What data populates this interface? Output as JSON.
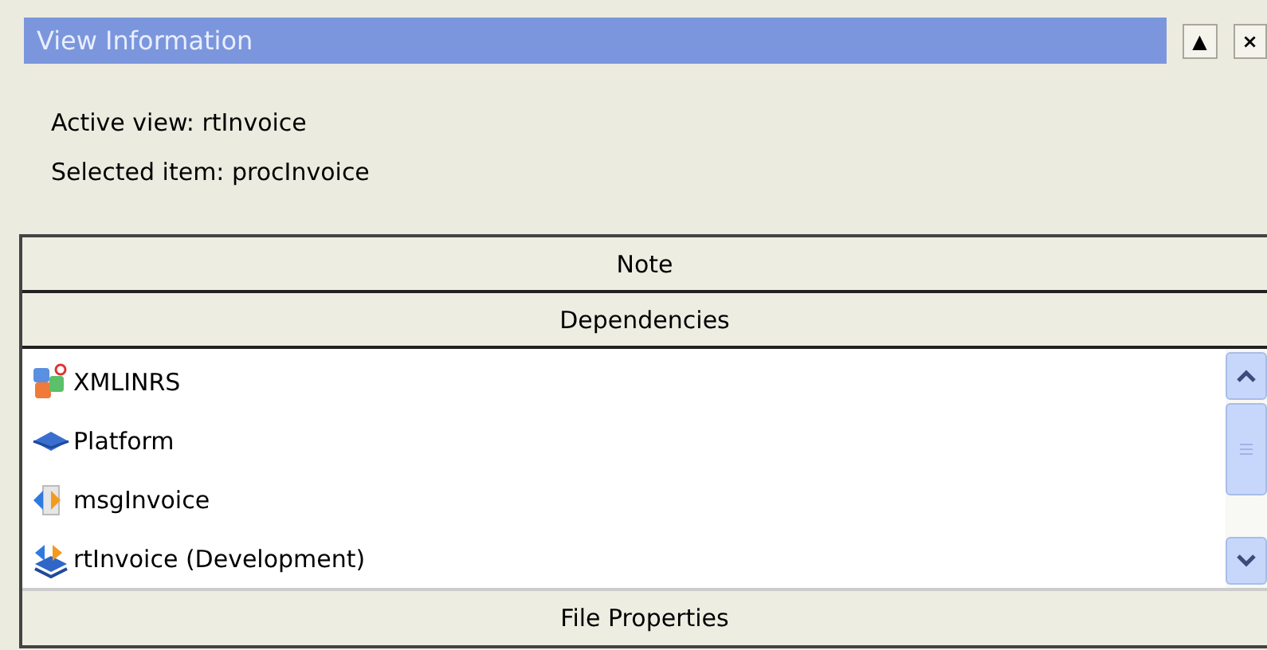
{
  "window": {
    "title": "View Information",
    "buttons": [
      "▲",
      "×"
    ]
  },
  "info": [
    "Active view: rtInvoice",
    "Selected item: procInvoice"
  ],
  "sections": [
    {
      "label": "Note"
    },
    {
      "label": "Dependencies"
    }
  ],
  "dependencies": [
    {
      "label": "XMLINRS",
      "kind": "package"
    },
    {
      "label": "Platform",
      "kind": "platform"
    },
    {
      "label": "msgInvoice",
      "kind": "message"
    },
    {
      "label": "rtInvoice (Development)",
      "kind": "route"
    }
  ],
  "footer_section": {
    "label": "File Properties"
  }
}
